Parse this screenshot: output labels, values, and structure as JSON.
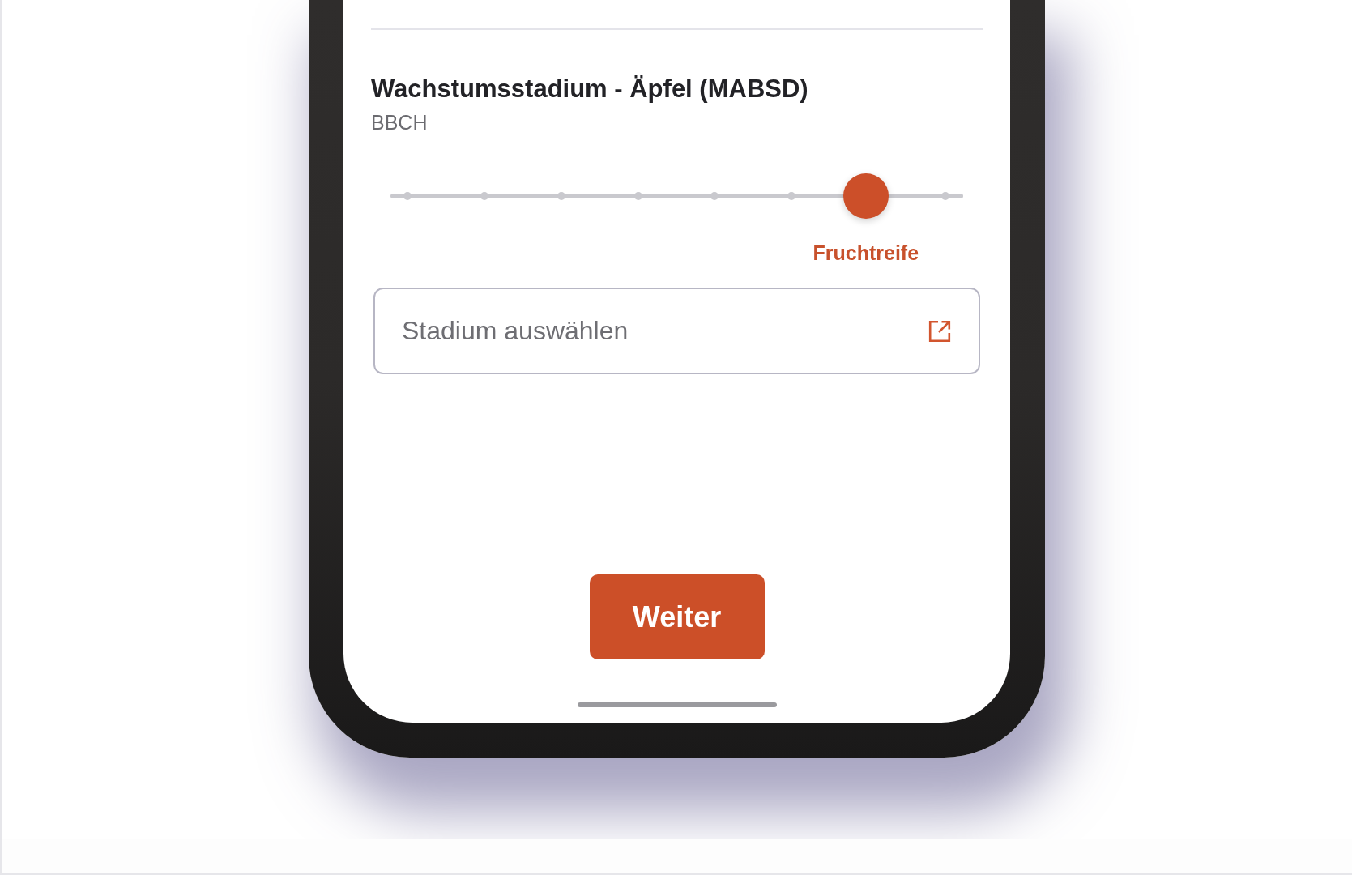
{
  "stage_section": {
    "title": "Wachstumsstadium - Äpfel (MABSD)",
    "subtitle": "BBCH",
    "slider": {
      "level": 0.83,
      "value_label": "Fruchtreife"
    },
    "stage_field": {
      "placeholder": "Stadium auswählen"
    }
  },
  "next_button": {
    "label": "Weiter"
  }
}
